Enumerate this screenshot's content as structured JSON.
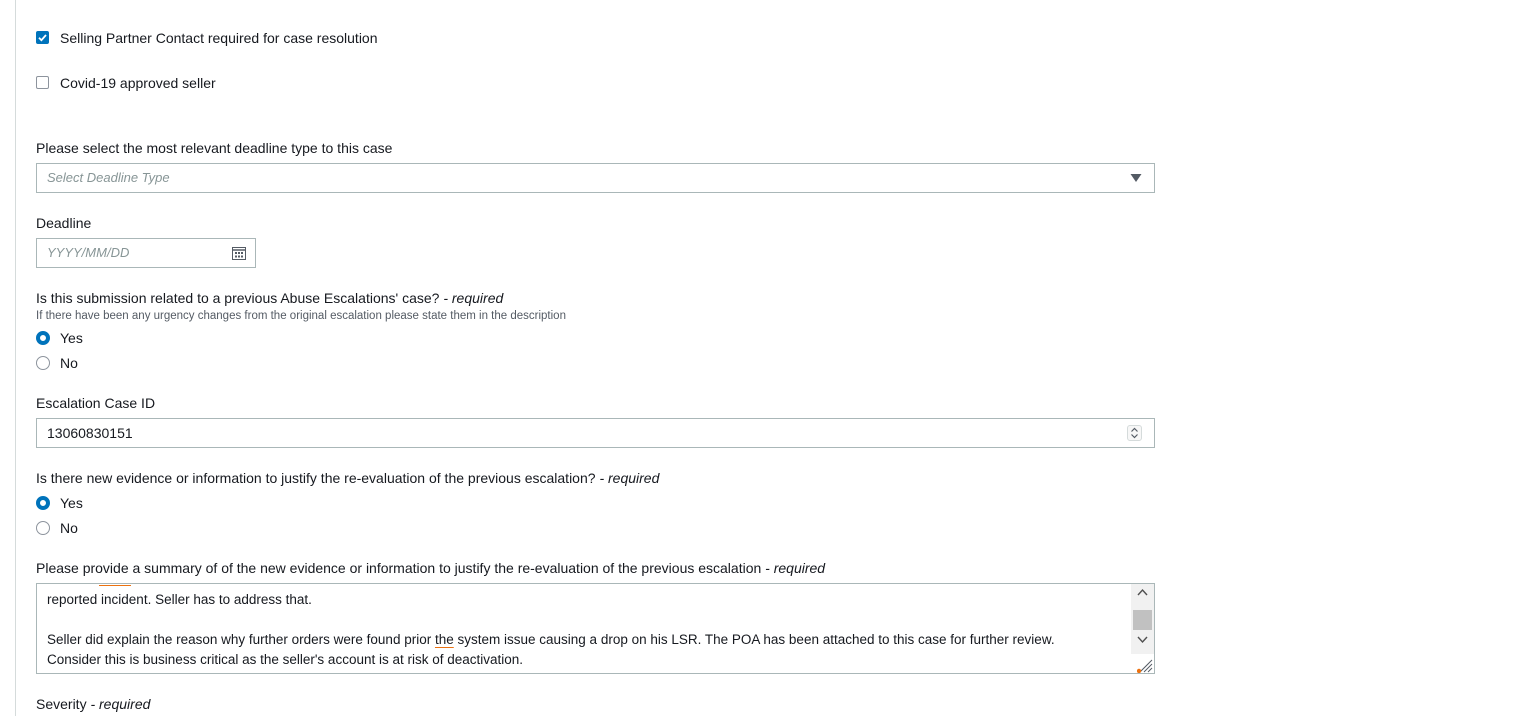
{
  "form": {
    "sp_contact": {
      "label": "Selling Partner Contact required for case resolution",
      "checked": true
    },
    "covid_seller": {
      "label": "Covid-19 approved seller",
      "checked": false
    },
    "deadline_type": {
      "label": "Please select the most relevant deadline type to this case",
      "placeholder": "Select Deadline Type",
      "icon": "caret-down-icon"
    },
    "deadline": {
      "label": "Deadline",
      "placeholder": "YYYY/MM/DD",
      "icon": "calendar-icon"
    },
    "previous_case": {
      "question": "Is this submission related to a previous Abuse Escalations' case?",
      "required": "- required",
      "hint": "If there have been any urgency changes from the original escalation please state them in the description",
      "options": [
        "Yes",
        "No"
      ],
      "selected": "Yes"
    },
    "escalation_id": {
      "label": "Escalation Case ID",
      "value": "13060830151"
    },
    "new_evidence": {
      "question": "Is there new evidence or information to justify the re-evaluation of the previous escalation?",
      "required": "- required",
      "options": [
        "Yes",
        "No"
      ],
      "selected": "Yes"
    },
    "summary": {
      "label": "Please provide a summary of of the new evidence or information to justify the re-evaluation of the previous escalation",
      "required": "- required",
      "line1": "reported incident. Seller has to address that.",
      "line2_a": "Seller did explain the reason why further orders were found prior ",
      "line2_b": "the",
      "line2_c": " system issue causing a drop on his LSR. The POA has been attached to this case for further review.",
      "line3": "Consider this is business critical as the seller's account is at risk of deactivation."
    },
    "severity": {
      "label": "Severity",
      "required": "- required"
    }
  },
  "colors": {
    "accent": "#0073bb",
    "border": "#aab7b8",
    "spell_underline": "#ec7211"
  }
}
